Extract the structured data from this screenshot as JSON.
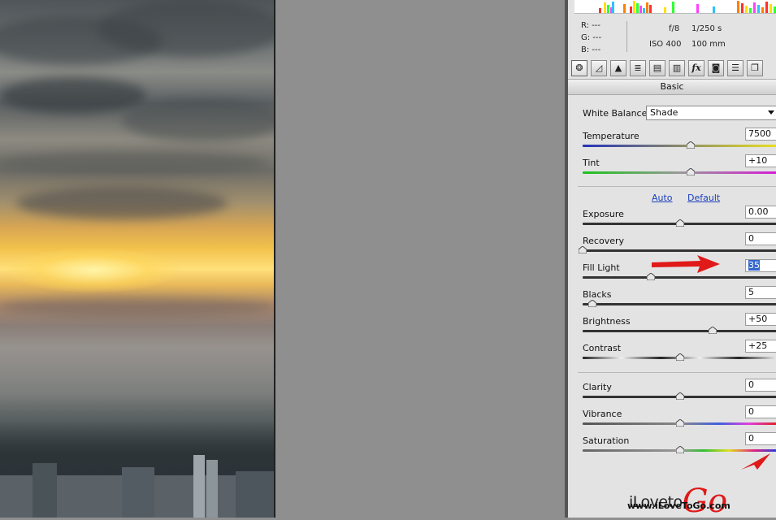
{
  "readout": {
    "r": "R:  ---",
    "g": "G:  ---",
    "b": "B:  ---"
  },
  "camera": {
    "aperture": "f/8",
    "shutter": "1/250 s",
    "iso": "ISO 400",
    "focal": "100 mm"
  },
  "tabs": [
    {
      "name": "basic",
      "icon": "aperture-icon",
      "glyph": "❂"
    },
    {
      "name": "tone-curve",
      "icon": "curve-icon",
      "glyph": "◿"
    },
    {
      "name": "detail",
      "icon": "detail-icon",
      "glyph": "▲"
    },
    {
      "name": "hsl",
      "icon": "hsl-icon",
      "glyph": "≣"
    },
    {
      "name": "split-toning",
      "icon": "split-icon",
      "glyph": "▤"
    },
    {
      "name": "lens",
      "icon": "lens-icon",
      "glyph": "▥"
    },
    {
      "name": "effects",
      "icon": "fx-icon",
      "glyph": "fx"
    },
    {
      "name": "camera-calibration",
      "icon": "camera-icon",
      "glyph": "◙"
    },
    {
      "name": "presets",
      "icon": "presets-icon",
      "glyph": "☰"
    },
    {
      "name": "snapshots",
      "icon": "snapshots-icon",
      "glyph": "❐"
    }
  ],
  "section_title": "Basic",
  "white_balance": {
    "label": "White Balance:",
    "value": "Shade"
  },
  "links": {
    "auto": "Auto",
    "default": "Default"
  },
  "sliders": {
    "temperature": {
      "label": "Temperature",
      "value": "7500",
      "position": 0.555
    },
    "tint": {
      "label": "Tint",
      "value": "+10",
      "position": 0.555
    },
    "exposure": {
      "label": "Exposure",
      "value": "0.00",
      "position": 0.5
    },
    "recovery": {
      "label": "Recovery",
      "value": "0",
      "position": 0.0
    },
    "fill_light": {
      "label": "Fill Light",
      "value": "35",
      "position": 0.35
    },
    "blacks": {
      "label": "Blacks",
      "value": "5",
      "position": 0.05
    },
    "brightness": {
      "label": "Brightness",
      "value": "+50",
      "position": 0.667
    },
    "contrast": {
      "label": "Contrast",
      "value": "+25",
      "position": 0.5
    },
    "clarity": {
      "label": "Clarity",
      "value": "0",
      "position": 0.5
    },
    "vibrance": {
      "label": "Vibrance",
      "value": "0",
      "position": 0.5
    },
    "saturation": {
      "label": "Saturation",
      "value": "0",
      "position": 0.5
    }
  },
  "colors": {
    "accent_red": "#e01919",
    "selection": "#3366cc"
  },
  "watermark": {
    "logo_prefix": "iLoveto",
    "logo_go": "Go",
    "url": "www.iLoveToGo.com"
  }
}
